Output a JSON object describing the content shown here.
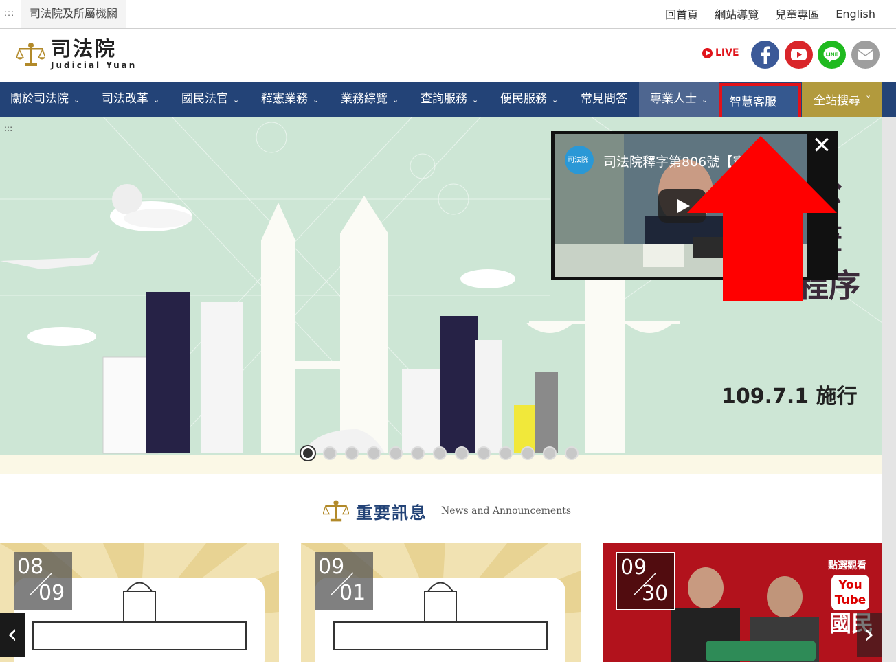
{
  "topbar": {
    "accesskey": ":::",
    "subsite": "司法院及所屬機關",
    "links": [
      "回首頁",
      "網站導覽",
      "兒童專區",
      "English"
    ]
  },
  "header": {
    "logo_zh": "司法院",
    "logo_en": "Judicial Yuan",
    "live_label": "LIVE",
    "social": [
      "facebook-icon",
      "youtube-icon",
      "line-icon",
      "mail-icon"
    ]
  },
  "nav": {
    "items": [
      "關於司法院",
      "司法改革",
      "國民法官",
      "釋憲業務",
      "業務綜覽",
      "查詢服務",
      "便民服務",
      "常見問答",
      "專業人士",
      "智慧客服",
      "全站搜尋"
    ]
  },
  "hero": {
    "accesskey": ":::",
    "slogan_chars": [
      "公",
      "畫",
      "程序"
    ],
    "effective_date": "109.7.1 施行",
    "video": {
      "title": "司法院釋字第806號【憲",
      "channel": "司法院"
    },
    "slide_count": 13,
    "active_slide": 1
  },
  "news": {
    "title_zh": "重要訊息",
    "title_en": "News and Announcements",
    "cards": [
      {
        "month": "08",
        "day": "09"
      },
      {
        "month": "09",
        "day": "01"
      },
      {
        "month": "09",
        "day": "30",
        "badge_top": "點選觀看",
        "badge": "You Tube",
        "chars": "國民"
      }
    ]
  },
  "colors": {
    "nav_bg": "#234377",
    "nav_active": "#4e6690",
    "search_tab": "#b29a3d",
    "highlight": "#e3121a",
    "hero_bg": "#cde6d5"
  }
}
